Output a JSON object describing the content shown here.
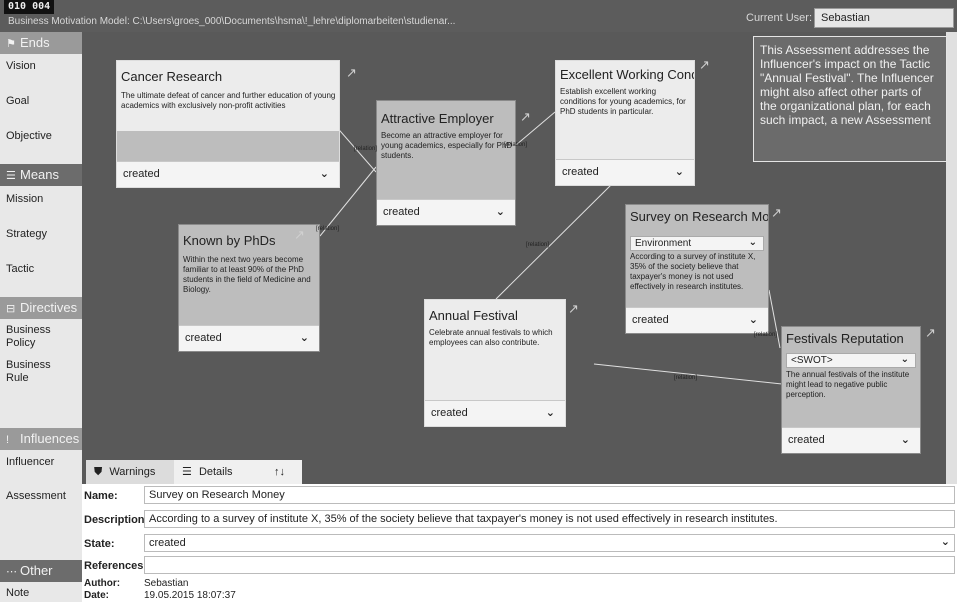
{
  "titlebar": {
    "counter": "010 004",
    "app_title": "Business Motivation Model: C:\\Users\\groes_000\\Documents\\hsma\\!_lehre\\diplomarbeiten\\studienar...",
    "user_label": "Current User:",
    "user_value": "Sebastian"
  },
  "palette": {
    "ends": {
      "header": "Ends",
      "items": [
        "Vision",
        "Goal",
        "Objective"
      ]
    },
    "means": {
      "header": "Means",
      "items": [
        "Mission",
        "Strategy",
        "Tactic"
      ]
    },
    "directives": {
      "header": "Directives",
      "items": [
        "Business\nPolicy",
        "Business\nRule"
      ]
    },
    "influences": {
      "header": "Influences",
      "items": [
        "Influencer",
        "Assessment"
      ]
    },
    "other": {
      "header": "Other",
      "items": [
        "Note"
      ]
    }
  },
  "nodes": {
    "cancer": {
      "title": "Cancer Research",
      "desc": "The ultimate defeat of cancer and further education of young academics with exclusively non-profit activities",
      "state": "created"
    },
    "employer": {
      "title": "Attractive Employer",
      "desc": "Become an attractive employer for young academics, especially for PhD students.",
      "state": "created"
    },
    "working": {
      "title": "Excellent Working Conditi",
      "desc": "Establish excellent working conditions for young academics, for PhD students in particular.",
      "state": "created"
    },
    "known": {
      "title": "Known by PhDs",
      "desc": "Within the next two years become familiar to at least 90% of the PhD students in the field of Medicine and Biology.",
      "state": "created"
    },
    "survey": {
      "title": "Survey on Research Mone",
      "category": "Environment",
      "desc": "According to a survey of institute X, 35% of the society believe that taxpayer's money is not used effectively in research institutes.",
      "state": "created"
    },
    "festival": {
      "title": "Annual Festival",
      "desc": "Celebrate annual festivals to which employees can also contribute.",
      "state": "created"
    },
    "reputation": {
      "title": "Festivals Reputation",
      "category": "<SWOT>",
      "desc": "The annual festivals of the institute might lead to negative public perception.",
      "state": "created"
    }
  },
  "relation_label": "[relation]",
  "tooltip": "This Assessment addresses the Influencer's impact on the Tactic \"Annual Festival\". The Influencer might also affect other parts of the organizational plan, for each such impact, a new Assessment",
  "tabs": {
    "warnings": "Warnings",
    "details": "Details",
    "sort_icon": "↑↓"
  },
  "details": {
    "name_label": "Name:",
    "name_value": "Survey on Research Money",
    "desc_label": "Description:",
    "desc_value": "According to a survey of institute X, 35% of the society believe that taxpayer's money is not used effectively in research institutes.",
    "state_label": "State:",
    "state_value": "created",
    "refs_label": "References:",
    "refs_value": "",
    "author_label": "Author:",
    "author_value": "Sebastian",
    "date_label": "Date:",
    "date_value": "19.05.2015 18:07:37"
  },
  "icons": {
    "expand": "expand-arrow-icon",
    "chevron": "chevron-down-icon",
    "warning": "shield-warning-icon",
    "list": "list-icon"
  }
}
